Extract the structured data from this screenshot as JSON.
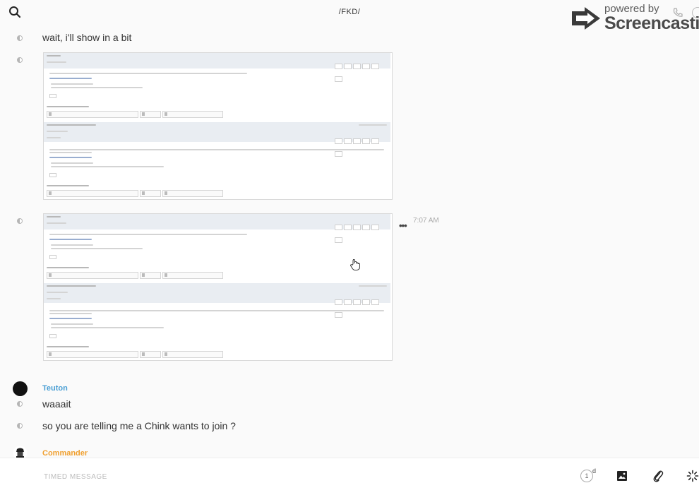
{
  "header": {
    "channel_title": "/FKD/",
    "search_icon": "search-icon"
  },
  "watermark": {
    "powered_by": "powered by",
    "brand": "Screencastify"
  },
  "messages": [
    {
      "text": "wait, i'll show in a bit"
    },
    {
      "text": "waaait",
      "author": "Teuton",
      "author_color": "#4a9fd4"
    },
    {
      "text": "so you are telling me a Chink wants to join ?"
    }
  ],
  "embedded_screenshot": {
    "time": "7:07 AM",
    "more_icon": "more-horizontal-icon"
  },
  "next_author": {
    "name": "Commander",
    "color": "#f0a030"
  },
  "composer": {
    "placeholder": "TIMED MESSAGE",
    "timer_value": "1",
    "timer_unit": "d",
    "icons": [
      "image-icon",
      "paperclip-icon",
      "loader-icon"
    ]
  }
}
